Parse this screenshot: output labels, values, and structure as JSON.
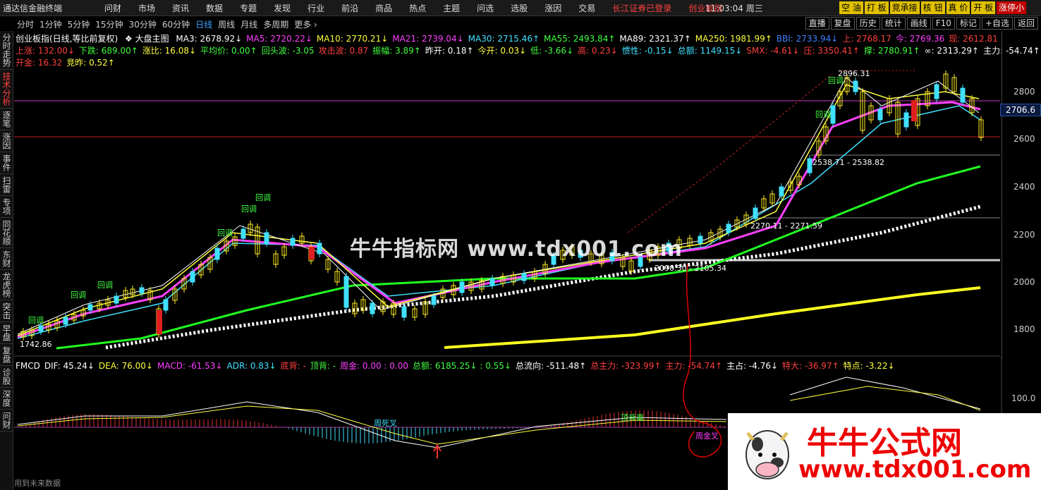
{
  "app": {
    "title": "通达信金融终端"
  },
  "menu": [
    "问财",
    "市场",
    "资讯",
    "数据",
    "专题",
    "发现",
    "行业",
    "前沿",
    "商品",
    "热点",
    "主题",
    "问选",
    "选股",
    "涨因",
    "交易"
  ],
  "menu_status": [
    "长江证券已登录",
    "创业板指"
  ],
  "clock": {
    "time": "11:03:04",
    "weekday": "周三"
  },
  "chips": [
    {
      "label": "空 油",
      "color": "yellow"
    },
    {
      "label": "打 板",
      "color": "yellow"
    },
    {
      "label": "竞承接",
      "color": "yellow"
    },
    {
      "label": "核 钮",
      "color": "yellow"
    },
    {
      "label": "真 价",
      "color": "yellow"
    },
    {
      "label": "开 板",
      "color": "yellow"
    },
    {
      "label": "涨停小",
      "color": "red"
    }
  ],
  "periods": {
    "items": [
      "分时",
      "1分钟",
      "5分钟",
      "15分钟",
      "30分钟",
      "60分钟",
      "日线",
      "周线",
      "月线",
      "多周期",
      "更多 ›"
    ],
    "active": "日线"
  },
  "toolbar_right": [
    "直播",
    "复盘",
    "历史",
    "统计",
    "画线",
    "F10",
    "标记",
    "+自选",
    "返回"
  ],
  "sidebar": {
    "tabs": [
      "分时走势",
      "技术分析",
      "逐笔",
      "涨因",
      "事件",
      "扫雷",
      "专项",
      "同花顺",
      "东财",
      "龙虎榜",
      "突击",
      "早盘",
      "复盘",
      "诊股",
      "深度",
      "问财"
    ],
    "active": "技术分析"
  },
  "main_info": {
    "title": "创业板指(日线,等比前复权)",
    "subtitle": "❖ 大盘主图",
    "ma": [
      {
        "label": "MA3: 2678.92↓",
        "color": "#ffffff"
      },
      {
        "label": "MA5: 2720.22↓",
        "color": "#ff40ff"
      },
      {
        "label": "MA10: 2770.21↓",
        "color": "#ffff40"
      },
      {
        "label": "MA21: 2739.04↓",
        "color": "#ff40ff"
      },
      {
        "label": "MA30: 2715.46↑",
        "color": "#40e0ff"
      },
      {
        "label": "MA55: 2493.84↑",
        "color": "#40ff40"
      },
      {
        "label": "MA89: 2321.37↑",
        "color": "#ffffff"
      },
      {
        "label": "MA250: 1981.99↑",
        "color": "#ffff40"
      },
      {
        "label": "BBI: 2733.94↓",
        "color": "#4080ff"
      },
      {
        "label": "上: 2768.17",
        "color": "#ff4040"
      },
      {
        "label": "今: 2769.36",
        "color": "#ff40ff"
      },
      {
        "label": "现: 2612.81",
        "color": "#ff4040"
      }
    ],
    "row2": [
      {
        "label": "上涨: 132.00↓",
        "color": "#ff4040"
      },
      {
        "label": "下跌: 689.00↑",
        "color": "#40ff40"
      },
      {
        "label": "涨比: 16.08↓",
        "color": "#ffff40"
      },
      {
        "label": "平均价: 0.00↑",
        "color": "#40ff40"
      },
      {
        "label": "回头波: -3.05",
        "color": "#40ff40"
      },
      {
        "label": "攻击波: 0.87",
        "color": "#ff4040"
      },
      {
        "label": "振幅: 3.89↑",
        "color": "#40ff40"
      },
      {
        "label": "昨开: 0.18↑",
        "color": "#ffffff"
      },
      {
        "label": "今开: 0.03↓",
        "color": "#ffff40"
      },
      {
        "label": "低: -3.66↓",
        "color": "#40ff40"
      },
      {
        "label": "高: 0.23↓",
        "color": "#ff4040"
      },
      {
        "label": "惯性: -0.15↓",
        "color": "#40e0ff"
      },
      {
        "label": "总额: 1149.15↓",
        "color": "#40e0ff"
      },
      {
        "label": "SMX: -4.61↓",
        "color": "#ff4040"
      },
      {
        "label": "压: 3350.41↑",
        "color": "#ff4040"
      },
      {
        "label": "撑: 2780.91↑",
        "color": "#40ff40"
      },
      {
        "label": "∞: 2313.29↑",
        "color": "#ffffff"
      },
      {
        "label": "主力: -54.74↑",
        "color": "#ffffff"
      }
    ],
    "row3": [
      {
        "label": "开金: 16.32",
        "color": "#ff4040"
      },
      {
        "label": "竞昨: 0.52↑",
        "color": "#ffff40"
      }
    ]
  },
  "price_axis": {
    "ticks": [
      "2800",
      "2600",
      "2400",
      "2200",
      "2000",
      "1800"
    ],
    "current": "2706.6"
  },
  "chart_labels": {
    "high": "2896.31",
    "low": "1742.86",
    "levels": [
      "2538.71 - 2538.82",
      "2270.11 - 2271.59",
      "2090.30 - 2105.34"
    ],
    "huitiao": "回调"
  },
  "watermark": "牛牛指标网 www.tdx001.com",
  "sub_info": {
    "items": [
      {
        "label": "FMCD",
        "color": "#ffffff"
      },
      {
        "label": "DIF: 45.24↓",
        "color": "#ffffff"
      },
      {
        "label": "DEA: 76.00↓",
        "color": "#ffff40"
      },
      {
        "label": "MACD: -61.53↓",
        "color": "#ff40ff"
      },
      {
        "label": "ADR: 0.83↓",
        "color": "#40e0ff"
      },
      {
        "label": "底背: -",
        "color": "#ff4040"
      },
      {
        "label": "顶背: -",
        "color": "#40ff40"
      },
      {
        "label": "周金: 0.00 : 0.00",
        "color": "#ff40ff"
      },
      {
        "label": "总额: 6185.25↓ : 0.55↓",
        "color": "#40ff40"
      },
      {
        "label": "总流向: -511.48↑",
        "color": "#ffffff"
      },
      {
        "label": "总主力: -323.99↑",
        "color": "#ff4040"
      },
      {
        "label": "主力: -54.74↑",
        "color": "#ff4040"
      },
      {
        "label": "主占: -4.76↓",
        "color": "#ffffff"
      },
      {
        "label": "特大: -36.97↑",
        "color": "#ff4040"
      },
      {
        "label": "特点: -3.22↓",
        "color": "#ffff40"
      }
    ],
    "tick": "100.0",
    "labels": [
      "周死叉",
      "顶背离",
      "周金叉"
    ]
  },
  "logo": {
    "line1": "牛牛公式网",
    "line2": "www.tdx001.com"
  },
  "footer": "用到未来数据"
}
